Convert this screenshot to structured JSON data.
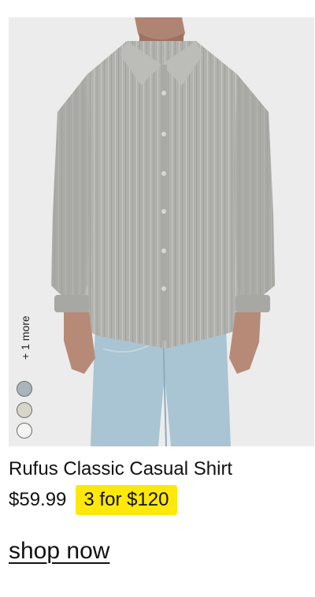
{
  "product": {
    "name": "Rufus Classic Casual Shirt",
    "price": "$59.99",
    "promo": "3 for $120",
    "more_colors_label": "+ 1 more",
    "swatches": [
      {
        "name": "grey-blue",
        "color": "#a9b5bb"
      },
      {
        "name": "stone",
        "color": "#d8d5cb"
      },
      {
        "name": "white",
        "color": "#f4f4f2"
      }
    ],
    "image_subject": "model-wearing-grey-striped-shirt"
  },
  "cta": {
    "label": "shop now"
  },
  "colors": {
    "promo_badge": "#ffe80a",
    "image_background": "#ececec",
    "text": "#111111"
  }
}
